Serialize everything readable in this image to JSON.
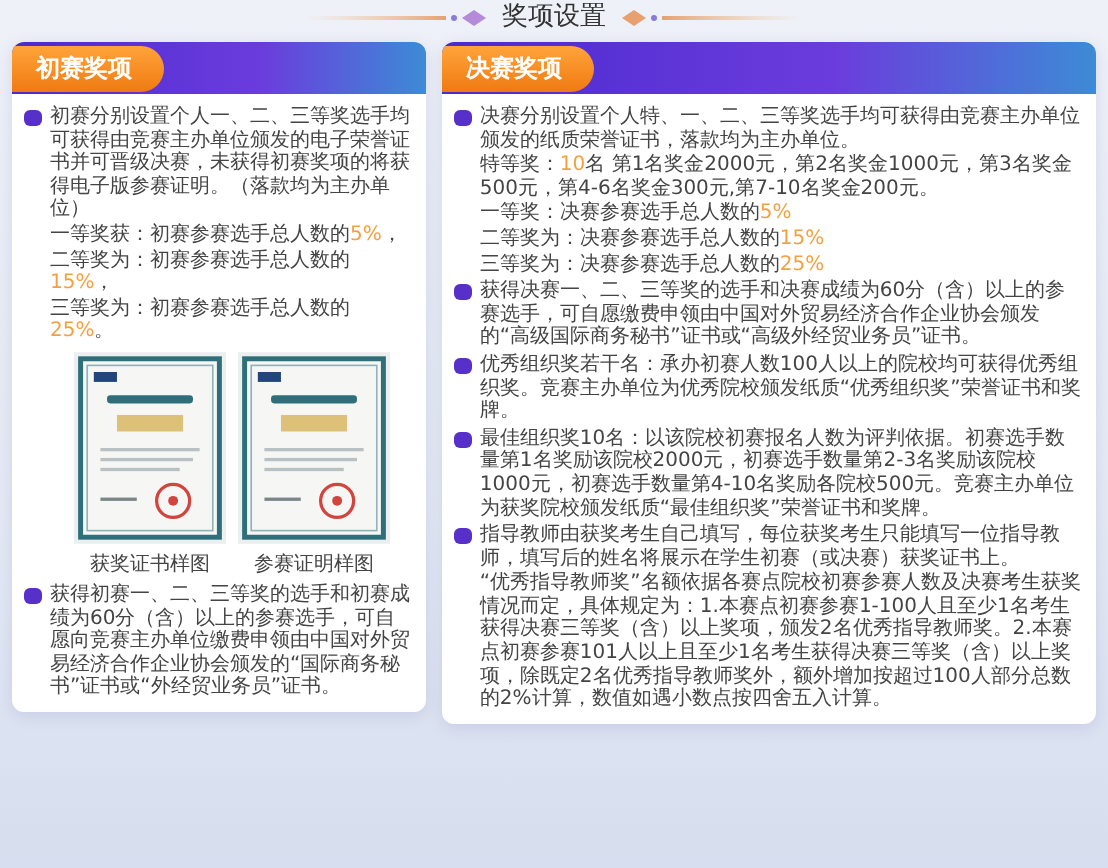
{
  "page_title": "奖项设置",
  "cards": [
    {
      "title": "初赛奖项",
      "blocks": [
        {
          "kind": "bullet",
          "parts": [
            {
              "text": "初赛分别设置个人一、二、三等奖选手均可获得由竞赛主办单位颁发的电子荣誉证书并可晋级决赛，未获得初赛奖项的将获得电子版参赛证明。（落款均为主办单位）",
              "accent": false
            }
          ]
        },
        {
          "kind": "line",
          "parts": [
            {
              "text": "一等奖获：初赛参赛选手总人数的",
              "accent": false
            },
            {
              "text": "5%",
              "accent": true
            },
            {
              "text": "，",
              "accent": false
            }
          ]
        },
        {
          "kind": "line",
          "parts": [
            {
              "text": "二等奖为：初赛参赛选手总人数的",
              "accent": false
            },
            {
              "text": "15%",
              "accent": true
            },
            {
              "text": "，",
              "accent": false
            }
          ]
        },
        {
          "kind": "line",
          "parts": [
            {
              "text": "三等奖为：初赛参赛选手总人数的",
              "accent": false
            },
            {
              "text": "25%",
              "accent": true
            },
            {
              "text": "。",
              "accent": false
            }
          ]
        },
        {
          "kind": "figures",
          "figures": [
            {
              "kind": "picture",
              "caption": "获奖证书样图"
            },
            {
              "kind": "picture",
              "caption": "参赛证明样图"
            }
          ]
        },
        {
          "kind": "bullet",
          "parts": [
            {
              "text": "获得初赛一、二、三等奖的选手和初赛成绩为60分（含）以上的参赛选手，可自愿向竞赛主办单位缴费申领由中国对外贸易经济合作企业协会颁发的“国际商务秘书”证书或“外经贸业务员”证书。",
              "accent": false
            }
          ]
        }
      ]
    },
    {
      "title": "决赛奖项",
      "blocks": [
        {
          "kind": "bullet",
          "parts": [
            {
              "text": "决赛分别设置个人特、一、二、三等奖选手均可获得由竞赛主办单位颁发的纸质荣誉证书，落款均为主办单位。",
              "accent": false
            }
          ]
        },
        {
          "kind": "line",
          "parts": [
            {
              "text": "特等奖：",
              "accent": false
            },
            {
              "text": "10",
              "accent": true
            },
            {
              "text": "名 第1名奖金2000元，第2名奖金1000元，第3名奖金500元，第4-6名奖金300元,第7-10名奖金200元。",
              "accent": false
            }
          ]
        },
        {
          "kind": "line",
          "parts": [
            {
              "text": "一等奖：决赛参赛选手总人数的",
              "accent": false
            },
            {
              "text": "5%",
              "accent": true
            }
          ]
        },
        {
          "kind": "line",
          "parts": [
            {
              "text": "二等奖为：决赛参赛选手总人数的",
              "accent": false
            },
            {
              "text": "15%",
              "accent": true
            }
          ]
        },
        {
          "kind": "line",
          "parts": [
            {
              "text": "三等奖为：决赛参赛选手总人数的",
              "accent": false
            },
            {
              "text": "25%",
              "accent": true
            }
          ]
        },
        {
          "kind": "bullet",
          "parts": [
            {
              "text": "获得决赛一、二、三等奖的选手和决赛成绩为60分（含）以上的参赛选手，可自愿缴费申领由中国对外贸易经济合作企业协会颁发的“高级国际商务秘书”证书或“高级外经贸业务员”证书。",
              "accent": false
            }
          ]
        },
        {
          "kind": "bullet",
          "parts": [
            {
              "text": "优秀组织奖若干名：承办初赛人数100人以上的院校均可获得优秀组织奖。竞赛主办单位为优秀院校颁发纸质“优秀组织奖”荣誉证书和奖牌。",
              "accent": false
            }
          ]
        },
        {
          "kind": "bullet",
          "parts": [
            {
              "text": "最佳组织奖10名：以该院校初赛报名人数为评判依据。初赛选手数量第1名奖励该院校2000元，初赛选手数量第2-3名奖励该院校1000元，初赛选手数量第4-10名奖励各院校500元。竞赛主办单位为获奖院校颁发纸质“最佳组织奖”荣誉证书和奖牌。",
              "accent": false
            }
          ]
        },
        {
          "kind": "bullet",
          "parts": [
            {
              "text": "指导教师由获奖考生自己填写，每位获奖考生只能填写一位指导教师，填写后的姓名将展示在学生初赛（或决赛）获奖证书上。",
              "accent": false
            }
          ]
        },
        {
          "kind": "line",
          "parts": [
            {
              "text": "“优秀指导教师奖”名额依据各赛点院校初赛参赛人数及决赛考生获奖情况而定，具体规定为：1.本赛点初赛参赛1-100人且至少1名考生获得决赛三等奖（含）以上奖项，颁发2名优秀指导教师奖。2.本赛点初赛参赛101人以上且至少1名考生获得决赛三等奖（含）以上奖项，除既定2名优秀指导教师奖外，额外增加按超过100人部分总数的2%计算，数值如遇小数点按四舍五入计算。",
              "accent": false
            }
          ]
        }
      ]
    }
  ]
}
